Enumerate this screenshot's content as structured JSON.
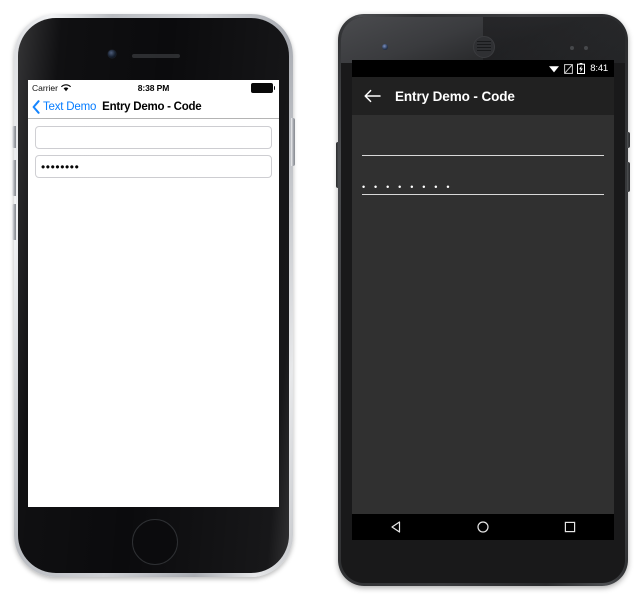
{
  "ios": {
    "status": {
      "carrier": "Carrier",
      "wifi_icon": "wifi-icon",
      "time": "8:38 PM",
      "battery_icon": "battery-full-icon"
    },
    "nav": {
      "back_icon": "chevron-left-icon",
      "back_label": "Text Demo",
      "title": "Entry Demo - Code"
    },
    "entries": [
      {
        "name": "entry-plain",
        "value": "",
        "placeholder": ""
      },
      {
        "name": "entry-password",
        "value": "••••••••",
        "placeholder": ""
      }
    ],
    "hardware": {
      "camera_icon": "front-camera-icon",
      "speaker_icon": "earpiece-speaker-icon",
      "home_button": "home-button"
    }
  },
  "android": {
    "status": {
      "wifi_icon": "wifi-icon",
      "signal_icon": "no-signal-icon",
      "battery_icon": "battery-charging-icon",
      "time": "8:41"
    },
    "toolbar": {
      "back_icon": "arrow-back-icon",
      "title": "Entry Demo - Code"
    },
    "entries": [
      {
        "name": "entry-plain",
        "value": "",
        "placeholder": ""
      },
      {
        "name": "entry-password",
        "value": "• • • • • • • •",
        "placeholder": ""
      }
    ],
    "navbar": {
      "back_icon": "nav-back-triangle-icon",
      "home_icon": "nav-home-circle-icon",
      "recents_icon": "nav-recents-square-icon"
    },
    "hardware": {
      "camera_icon": "front-camera-icon",
      "earpiece_icon": "earpiece-speaker-icon"
    }
  },
  "colors": {
    "ios_tint": "#007aff",
    "ios_screen_bg": "#ffffff",
    "android_screen_bg": "#303030",
    "android_toolbar_bg": "#212121",
    "android_status_bg": "#000000",
    "android_text": "#ffffff"
  }
}
